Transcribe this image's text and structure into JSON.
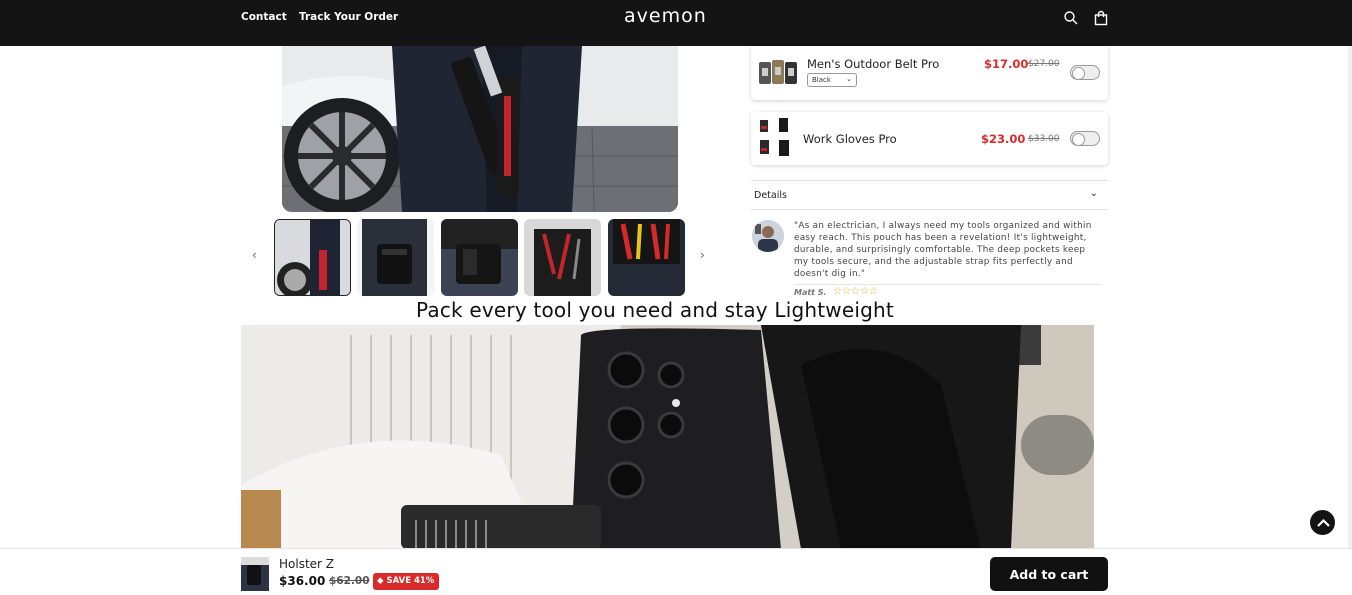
{
  "header": {
    "logo": "avemon",
    "nav": {
      "contact": "Contact",
      "track": "Track Your Order"
    }
  },
  "upsells": [
    {
      "name": "Men's Outdoor Belt Pro",
      "price": "$17.00",
      "compare": "$27.00",
      "variant": "Black",
      "enabled": false
    },
    {
      "name": "Work Gloves Pro",
      "price": "$23.00",
      "compare": "$33.00",
      "enabled": false
    }
  ],
  "details": {
    "label": "Details"
  },
  "review": {
    "text": "\"As an electrician, I always need my tools organized and within easy reach. This pouch has been a revelation! It's lightweight, durable, and surprisingly comfortable. The deep pockets keep my tools secure, and the adjustable strap fits perfectly and doesn't dig in.\"",
    "author": "Matt S.",
    "stars": "☆☆☆☆☆",
    "rating": 5
  },
  "section": {
    "title": "Pack every tool you need and stay Lightweight"
  },
  "sticky": {
    "name": "Holster Z",
    "price": "$36.00",
    "compare": "$62.00",
    "badge": "SAVE 41%",
    "cta": "Add to cart"
  },
  "colors": {
    "header_bg": "#141414",
    "sale_red": "#d92b2b",
    "button_bg": "#111111"
  }
}
